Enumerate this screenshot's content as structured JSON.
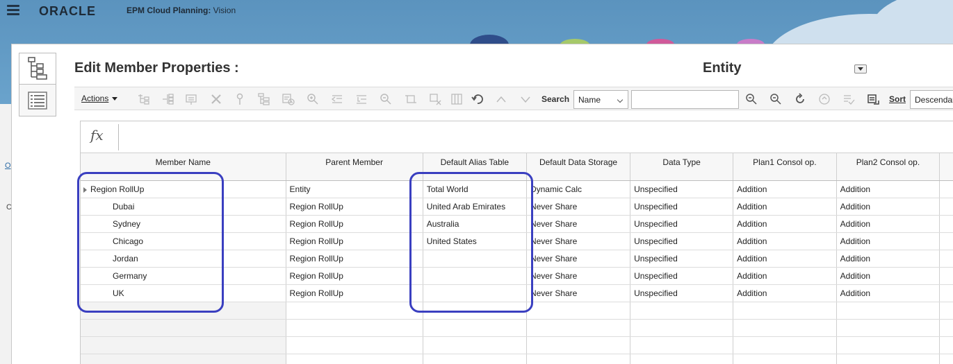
{
  "app": {
    "brand": "ORACLE",
    "product_bold": "EPM Cloud Planning:",
    "product_name": " Vision"
  },
  "background": {
    "link_fragment": "O",
    "text_fragment": "C"
  },
  "dialog": {
    "title": "Edit Member Properties :",
    "dimension": "Entity"
  },
  "toolbar": {
    "actions_label": "Actions",
    "search_label": "Search",
    "search_field": "Name",
    "search_value": "",
    "sort_label": "Sort",
    "sort_value": "Descendants"
  },
  "grid": {
    "columns": [
      "Member Name",
      "Parent Member",
      "Default Alias Table",
      "Default Data Storage",
      "Data Type",
      "Plan1 Consol op.",
      "Plan2 Consol op."
    ],
    "rows": [
      {
        "member": "Region RollUp",
        "parent": "Entity",
        "alias": "Total World",
        "storage": "Dynamic Calc",
        "type": "Unspecified",
        "plan1": "Addition",
        "plan2": "Addition"
      },
      {
        "member": "Dubai",
        "parent": "Region RollUp",
        "alias": "United Arab Emirates",
        "storage": "Never Share",
        "type": "Unspecified",
        "plan1": "Addition",
        "plan2": "Addition"
      },
      {
        "member": "Sydney",
        "parent": "Region RollUp",
        "alias": "Australia",
        "storage": "Never Share",
        "type": "Unspecified",
        "plan1": "Addition",
        "plan2": "Addition"
      },
      {
        "member": "Chicago",
        "parent": "Region RollUp",
        "alias": "United States",
        "storage": "Never Share",
        "type": "Unspecified",
        "plan1": "Addition",
        "plan2": "Addition"
      },
      {
        "member": "Jordan",
        "parent": "Region RollUp",
        "alias": "",
        "storage": "Never Share",
        "type": "Unspecified",
        "plan1": "Addition",
        "plan2": "Addition"
      },
      {
        "member": "Germany",
        "parent": "Region RollUp",
        "alias": "",
        "storage": "Never Share",
        "type": "Unspecified",
        "plan1": "Addition",
        "plan2": "Addition"
      },
      {
        "member": "UK",
        "parent": "Region RollUp",
        "alias": "",
        "storage": "Never Share",
        "type": "Unspecified",
        "plan1": "Addition",
        "plan2": "Addition"
      }
    ]
  },
  "colors": {
    "header_blue": "#5b93be",
    "highlight": "#3a3fc0"
  }
}
